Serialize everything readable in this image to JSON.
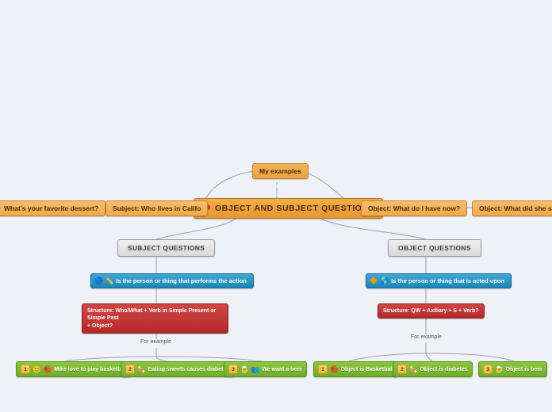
{
  "central": {
    "label": "OBJECT AND SUBJECT QUESTIONS",
    "icon": "pin-icon"
  },
  "top": {
    "label": "My examples"
  },
  "connector": {
    "up_arrow": "↑",
    "divider": "|",
    "down_arrow": "↓"
  },
  "examples_row": [
    {
      "label": "What's your favorite dessert?"
    },
    {
      "label": "Subject: Who lives in Califo"
    },
    {
      "label": "Object: What do I have now?"
    },
    {
      "label": "Object: What did she sa"
    }
  ],
  "branches": [
    {
      "title": "SUBJECT QUESTIONS",
      "definition": {
        "icons": [
          "blue-circle-icon",
          "pencil-icon"
        ],
        "text": "Is the person or thing that performs the action"
      },
      "structure": {
        "line1": "Structure: Who/What + Verb in Simple Present or Simple Past",
        "line2": "+ Object?"
      },
      "for_example": "For example",
      "examples": [
        {
          "number": "1",
          "icons": [
            "smiley-icon",
            "basketball-icon"
          ],
          "text": "Mike love to play basketball"
        },
        {
          "number": "2",
          "icons": [
            "candy-icon"
          ],
          "text": "Eating sweets causes diabetes"
        },
        {
          "number": "3",
          "icons": [
            "beer-icon",
            "people-icon"
          ],
          "text": "We want a beer"
        }
      ]
    },
    {
      "title": "OBJECT QUESTIONS",
      "definition": {
        "icons": [
          "gem-icon",
          "globe-icon"
        ],
        "text": "Is the person or thing that is acted upon"
      },
      "structure": {
        "line1": "Structure: QW + Axiliary + S + Verb?",
        "line2": ""
      },
      "for_example": "For example",
      "examples": [
        {
          "number": "1",
          "icons": [
            "basketball-icon"
          ],
          "text": "Object is Basketball"
        },
        {
          "number": "2",
          "icons": [
            "candy-icon"
          ],
          "text": "Object is diabetes"
        },
        {
          "number": "3",
          "icons": [
            "beer-icon"
          ],
          "text": "Object is beer"
        }
      ]
    }
  ],
  "colors": {
    "central": "#eca23c",
    "blue": "#1d86b8",
    "red": "#b42a2a",
    "green": "#6fae26",
    "grey": "#d8d8d8",
    "line": "#9aa3ab",
    "background": "#eef2f7"
  }
}
